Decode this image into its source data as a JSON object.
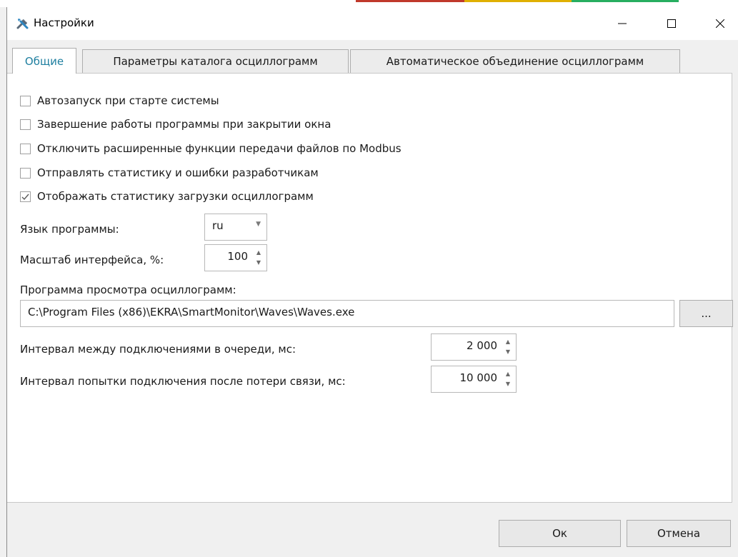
{
  "window": {
    "title": "Настройки",
    "icon": "tools-icon"
  },
  "controls": {
    "minimize": "—",
    "maximize": "☐",
    "close": "✕"
  },
  "tabs": [
    {
      "label": "Общие",
      "active": true
    },
    {
      "label": "Параметры каталога осциллограмм",
      "active": false
    },
    {
      "label": "Автоматическое объединение осциллограмм",
      "active": false
    }
  ],
  "checkboxes": [
    {
      "label": "Автозапуск при старте системы",
      "checked": false
    },
    {
      "label": "Завершение работы программы при закрытии окна",
      "checked": false
    },
    {
      "label": "Отключить расширенные функции передачи файлов по Modbus",
      "checked": false
    },
    {
      "label": "Отправлять статистику и ошибки разработчикам",
      "checked": false
    },
    {
      "label": "Отображать статистику загрузки осциллограмм",
      "checked": true
    }
  ],
  "language": {
    "label": "Язык программы:",
    "value": "ru"
  },
  "scale": {
    "label": "Масштаб интерфейса, %:",
    "value": "100"
  },
  "viewer": {
    "label": "Программа просмотра осциллограмм:",
    "path": "C:\\Program Files (x86)\\EKRA\\SmartMonitor\\Waves\\Waves.exe",
    "browse": "..."
  },
  "queue_interval": {
    "label": "Интервал между подключениями в очереди, мс:",
    "value": "2 000"
  },
  "reconnect_interval": {
    "label": "Интервал попытки подключения после потери связи, мс:",
    "value": "10 000"
  },
  "buttons": {
    "ok": "Ок",
    "cancel": "Отмена"
  },
  "colors": {
    "accent": "#1f7fa0",
    "check": "#5a5a5a"
  }
}
